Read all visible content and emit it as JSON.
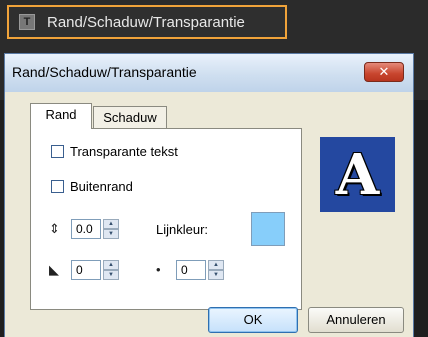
{
  "host": {
    "menu_label": "Rand/Schaduw/Transparantie",
    "menu_icon": "text-icon",
    "menu_icon_glyph": "T",
    "highlight_color": "#f0a33a"
  },
  "dialog": {
    "title": "Rand/Schaduw/Transparantie",
    "close_glyph": "✕",
    "tabs": [
      {
        "label": "Rand",
        "active": true
      },
      {
        "label": "Schaduw",
        "active": false
      }
    ],
    "rand": {
      "transparent_text_label": "Transparante tekst",
      "transparent_text_checked": false,
      "outline_label": "Buitenrand",
      "outline_checked": false,
      "border_width_value": "0.0",
      "line_color_label": "Lijnkleur:",
      "line_color": "#87cefa",
      "gradient_value": "0",
      "blur_value": "0"
    },
    "preview": {
      "glyph": "A",
      "background": "#2448a0"
    },
    "buttons": {
      "ok": "OK",
      "cancel": "Annuleren"
    }
  }
}
